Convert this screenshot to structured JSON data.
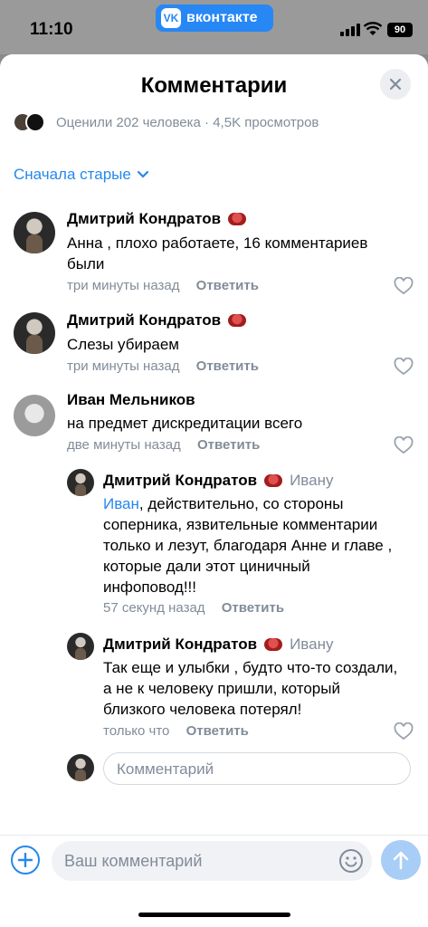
{
  "status_bar": {
    "time": "11:10",
    "app_pill": "вконтакте",
    "vk_logo": "VK",
    "battery": "90"
  },
  "sheet": {
    "title": "Комментарии",
    "likes_summary": "Оценили 202 человека · 4,5K просмотров",
    "sort_label": "Сначала старые"
  },
  "comments": [
    {
      "author": "Дмитрий Кондратов",
      "text": "Анна , плохо работаете, 16 комментариев были",
      "time": "три минуты назад",
      "reply": "Ответить"
    },
    {
      "author": "Дмитрий Кондратов",
      "text": "Слезы убираем",
      "time": "три минуты назад",
      "reply": "Ответить"
    },
    {
      "author": "Иван Мельников",
      "text": "на предмет дискредитации всего",
      "time": "две минуты назад",
      "reply": "Ответить"
    }
  ],
  "replies": [
    {
      "author": "Дмитрий Кондратов",
      "reply_to": "Ивану",
      "mention": "Иван",
      "text": ", действительно, со стороны соперника, язвительные комментарии только и лезут, благодаря Анне и главе , которые дали этот циничный инфоповод!!!",
      "time": "57 секунд назад",
      "reply": "Ответить"
    },
    {
      "author": "Дмитрий Кондратов",
      "reply_to": "Ивану",
      "text": "Так еще и улыбки , будто что-то создали, а не к человеку пришли, который близкого человека потерял!",
      "time": "только что",
      "reply": "Ответить"
    }
  ],
  "thread_input": {
    "placeholder": "Комментарий"
  },
  "bottom": {
    "placeholder": "Ваш комментарий"
  }
}
